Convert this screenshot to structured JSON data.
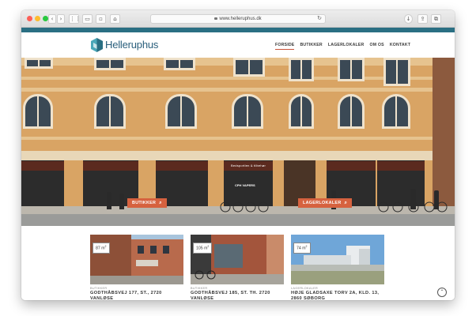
{
  "browser": {
    "url": "www.helleruphus.dk",
    "back_icon": "chevron-left-icon",
    "forward_icon": "chevron-right-icon",
    "reload_icon": "reload-icon"
  },
  "site": {
    "brand": "Helleruphus",
    "accent": "#d6623f",
    "brand_color": "#2a5f7c",
    "nav": [
      {
        "label": "FORSIDE",
        "active": true
      },
      {
        "label": "BUTIKKER"
      },
      {
        "label": "LAGERLOKALER"
      },
      {
        "label": "OM OS"
      },
      {
        "label": "KONTAKT"
      }
    ]
  },
  "hero": {
    "cta_shops": "BUTIKKER",
    "cta_storage": "LAGERLOKALER",
    "awnings": [
      "Bedsportlen & tilbehør",
      "CPH VAPERS"
    ]
  },
  "listings": [
    {
      "size": "87 m",
      "unit_sup": "2",
      "category": "BUTIKKER",
      "address": "GODTHÅBSVEJ 177, ST., 2720 VANLØSE"
    },
    {
      "size": "105 m",
      "unit_sup": "2",
      "category": "BUTIKKER",
      "address": "GODTHÅBSVEJ 185, ST. TH. 2720 VANLØSE"
    },
    {
      "size": "74 m",
      "unit_sup": "2",
      "category": "LAGERLOKALER",
      "address": "HØJE GLADSAXE TORV 2A, KLD. 13, 2860 SØBORG"
    }
  ]
}
